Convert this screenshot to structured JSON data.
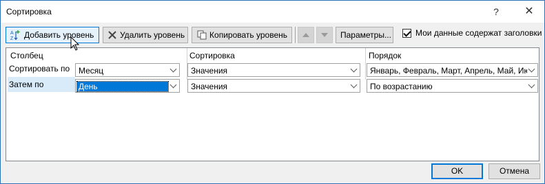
{
  "window": {
    "title": "Сортировка",
    "help_label": "?",
    "close_label": "✕"
  },
  "toolbar": {
    "add_level": "Добавить уровень",
    "delete_level": "Удалить уровень",
    "copy_level": "Копировать уровень",
    "options": "Параметры...",
    "headers_checkbox_label": "Мои данные содержат заголовки",
    "headers_checked": true
  },
  "columns": {
    "column": "Столбец",
    "sort_on": "Сортировка",
    "order": "Порядок"
  },
  "rows": [
    {
      "label": "Сортировать по",
      "column": "Месяц",
      "sort_on": "Значения",
      "order": "Январь, Февраль, Март, Апрель, Май, Июнь"
    },
    {
      "label": "Затем по",
      "column": "День",
      "sort_on": "Значения",
      "order": "По возрастанию"
    }
  ],
  "footer": {
    "ok": "OK",
    "cancel": "Отмена"
  },
  "colors": {
    "accent": "#0078d7",
    "selection": "#d9ebf9"
  }
}
